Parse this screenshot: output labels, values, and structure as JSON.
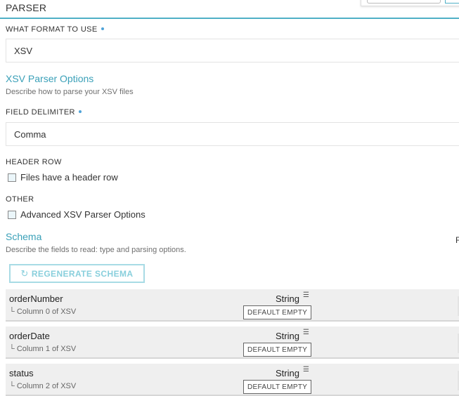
{
  "parser": {
    "section_title": "PARSER",
    "format_label": "WHAT FORMAT TO USE",
    "format_value": "XSV"
  },
  "xsv_options": {
    "heading": "XSV Parser Options",
    "description": "Describe how to parse your XSV files",
    "delimiter_label": "FIELD DELIMITER",
    "delimiter_value": "Comma",
    "header_row_label": "HEADER ROW",
    "header_row_checkbox": "Files have a header row",
    "header_row_checked": false,
    "other_label": "OTHER",
    "advanced_checkbox": "Advanced XSV Parser Options",
    "advanced_checked": false
  },
  "schema": {
    "heading": "Schema",
    "description": "Describe the fields to read: type and parsing options.",
    "regenerate_label": "REGENERATE SCHEMA",
    "cut_text": "F",
    "fields": [
      {
        "name": "orderNumber",
        "source": "Column 0 of XSV",
        "type": "String",
        "default": "DEFAULT EMPTY"
      },
      {
        "name": "orderDate",
        "source": "Column 1 of XSV",
        "type": "String",
        "default": "DEFAULT EMPTY"
      },
      {
        "name": "status",
        "source": "Column 2 of XSV",
        "type": "String",
        "default": "DEFAULT EMPTY"
      }
    ]
  },
  "icons": {
    "refresh": "refresh-icon",
    "type": "type-icon",
    "tree_branch": "tree-branch-icon"
  },
  "colors": {
    "accent": "#4fb0c6",
    "heading": "#3aa0b8",
    "required_dot": "#4fa3d8",
    "row_bg": "#efefef"
  }
}
